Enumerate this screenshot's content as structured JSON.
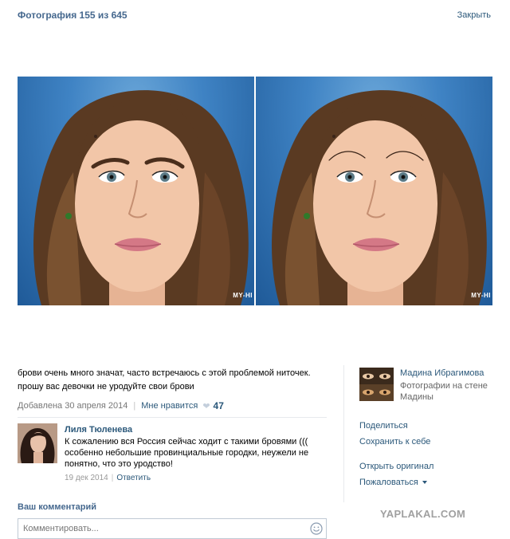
{
  "header": {
    "photo_counter": "Фотография 155 из 645",
    "close_label": "Закрыть"
  },
  "photo": {
    "left_watermark": "MY-HI",
    "right_watermark": "MY-HI"
  },
  "post": {
    "description_line1": "брови очень много значат, часто встречаюсь с этой проблемой ниточек.",
    "description_line2": "прошу вас девочки не уродуйте свои брови",
    "date": "Добавлена 30 апреля 2014",
    "like_label": "Мне нравится",
    "like_count": "47"
  },
  "comments": [
    {
      "author": "Лиля Тюленева",
      "text": "К сожалению вся Россия сейчас ходит с такими бровями ((( особенно небольшие провинциальные городки, неужели не понятно, что это уродство!",
      "date": "19 дек 2014",
      "reply_label": "Ответить"
    }
  ],
  "comment_form": {
    "title": "Ваш комментарий",
    "placeholder": "Комментировать..."
  },
  "sidebar": {
    "owner_name": "Мадина Ибрагимова",
    "owner_album": "Фотографии на стене Мадины",
    "share_label": "Поделиться",
    "save_label": "Сохранить к себе",
    "open_original_label": "Открыть оригинал",
    "complain_label": "Пожаловаться"
  },
  "site_watermark": "YAPLAKAL.COM",
  "colors": {
    "link": "#2b587a",
    "header_blue": "#45688e",
    "muted": "#777777"
  }
}
